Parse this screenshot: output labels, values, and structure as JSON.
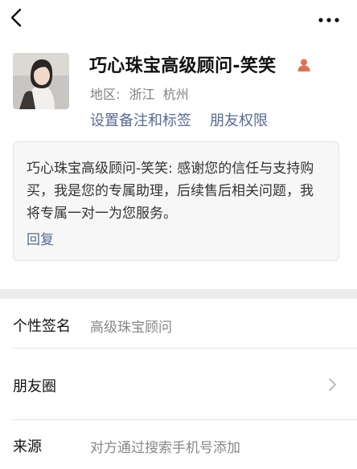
{
  "topbar": {
    "back_icon": "chevron-left-icon",
    "more_icon": "more-horizontal-icon"
  },
  "profile": {
    "name": "巧心珠宝高级顾问-笑笑",
    "badge_icon": "person-icon",
    "badge_color": "#e0704f",
    "region_label": "地区:",
    "region_value": "浙江  杭州",
    "actions": [
      {
        "label": "设置备注和标签"
      },
      {
        "label": "朋友权限"
      }
    ]
  },
  "message": {
    "text": "巧心珠宝高级顾问-笑笑: 感谢您的信任与支持购买，我是您的专属助理，后续售后相关问题，我将专属一对一为您服务。",
    "reply_label": "回复"
  },
  "info_rows": [
    {
      "label": "个性签名",
      "value": "高级珠宝顾问"
    },
    {
      "label": "朋友圈",
      "value": ""
    },
    {
      "label": "来源",
      "value": "对方通过搜索手机号添加"
    }
  ],
  "colors": {
    "link": "#576b95",
    "secondary_text": "#888888",
    "band": "#ededed"
  }
}
